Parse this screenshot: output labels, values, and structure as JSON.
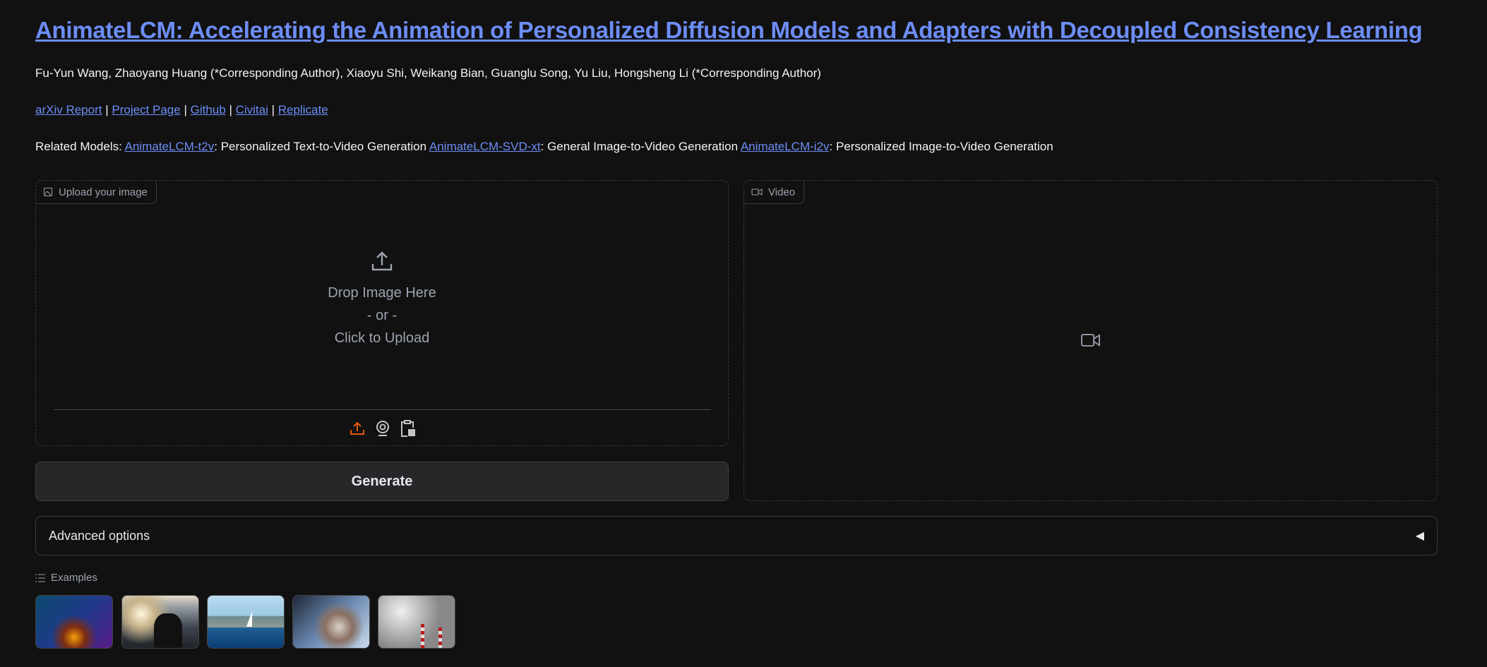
{
  "header": {
    "title": "AnimateLCM: Accelerating the Animation of Personalized Diffusion Models and Adapters with Decoupled Consistency Learning",
    "authors": "Fu-Yun Wang, Zhaoyang Huang (*Corresponding Author), Xiaoyu Shi, Weikang Bian, Guanglu Song, Yu Liu, Hongsheng Li (*Corresponding Author)",
    "links": [
      "arXiv Report",
      "Project Page",
      "Github",
      "Civitai",
      "Replicate"
    ],
    "separator": "|",
    "related_prefix": "Related Models: ",
    "related": [
      {
        "link": "AnimateLCM-t2v",
        "desc": ": Personalized Text-to-Video Generation "
      },
      {
        "link": "AnimateLCM-SVD-xt",
        "desc": ": General Image-to-Video Generation "
      },
      {
        "link": "AnimateLCM-i2v",
        "desc": ": Personalized Image-to-Video Generation"
      }
    ]
  },
  "upload": {
    "label": "Upload your image",
    "drop": "Drop Image Here",
    "or": "- or -",
    "click": "Click to Upload",
    "icons": [
      "upload-icon",
      "webcam-icon",
      "clipboard-icon"
    ],
    "active_color": "#ea580c"
  },
  "video": {
    "label": "Video"
  },
  "generate_label": "Generate",
  "advanced": {
    "label": "Advanced options",
    "toggle": "◀"
  },
  "examples": {
    "label": "Examples",
    "items": [
      "cyberpunk-figure",
      "dog-in-water",
      "sailboat",
      "woman-blowing-snow",
      "smokestacks"
    ]
  }
}
